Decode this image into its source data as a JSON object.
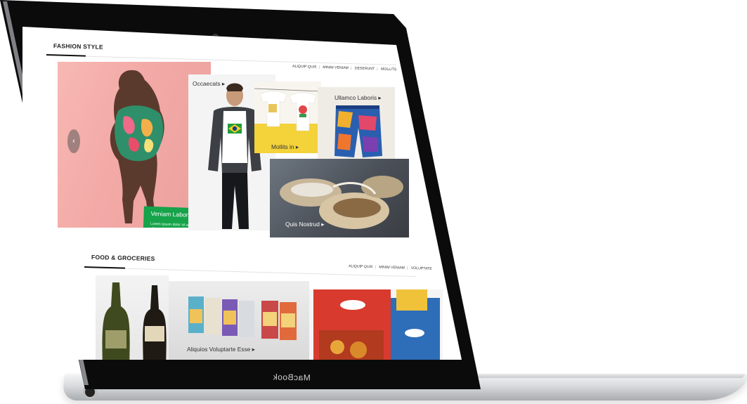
{
  "device": {
    "brand": "MacBook"
  },
  "fashion": {
    "heading": "FASHION STYLE",
    "nav": [
      "ALIQUIP QUIS",
      "MINIM VENIAM",
      "DESERUNT",
      "MOLLITS"
    ],
    "hero": {
      "title": "Veniam Labore Ellits",
      "text": "Lorem ipsum dolor sit amet, consectetur adipiscing elit, sed do eiusmod tempor incididunt ut labore et"
    },
    "tiles": {
      "occaecats": "Occaecats",
      "mollits": "Mollits in",
      "ullamco": "Ullamco Laboris",
      "quis": "Quis Nostrud"
    }
  },
  "food": {
    "heading": "FOOD & GROCERIES",
    "nav": [
      "ALIQUIP QUIS",
      "MINIM VENIAM",
      "VOLUPTATE"
    ],
    "tiles": {
      "snacks": "Aliquios Voluptarte Esse"
    }
  },
  "colors": {
    "accent": "#16a34a",
    "bezel": "#0b0b0b"
  },
  "icons": {
    "prev": "chevron-left-icon",
    "next": "chevron-right-icon",
    "tile_arrow": "caret-right-icon"
  }
}
